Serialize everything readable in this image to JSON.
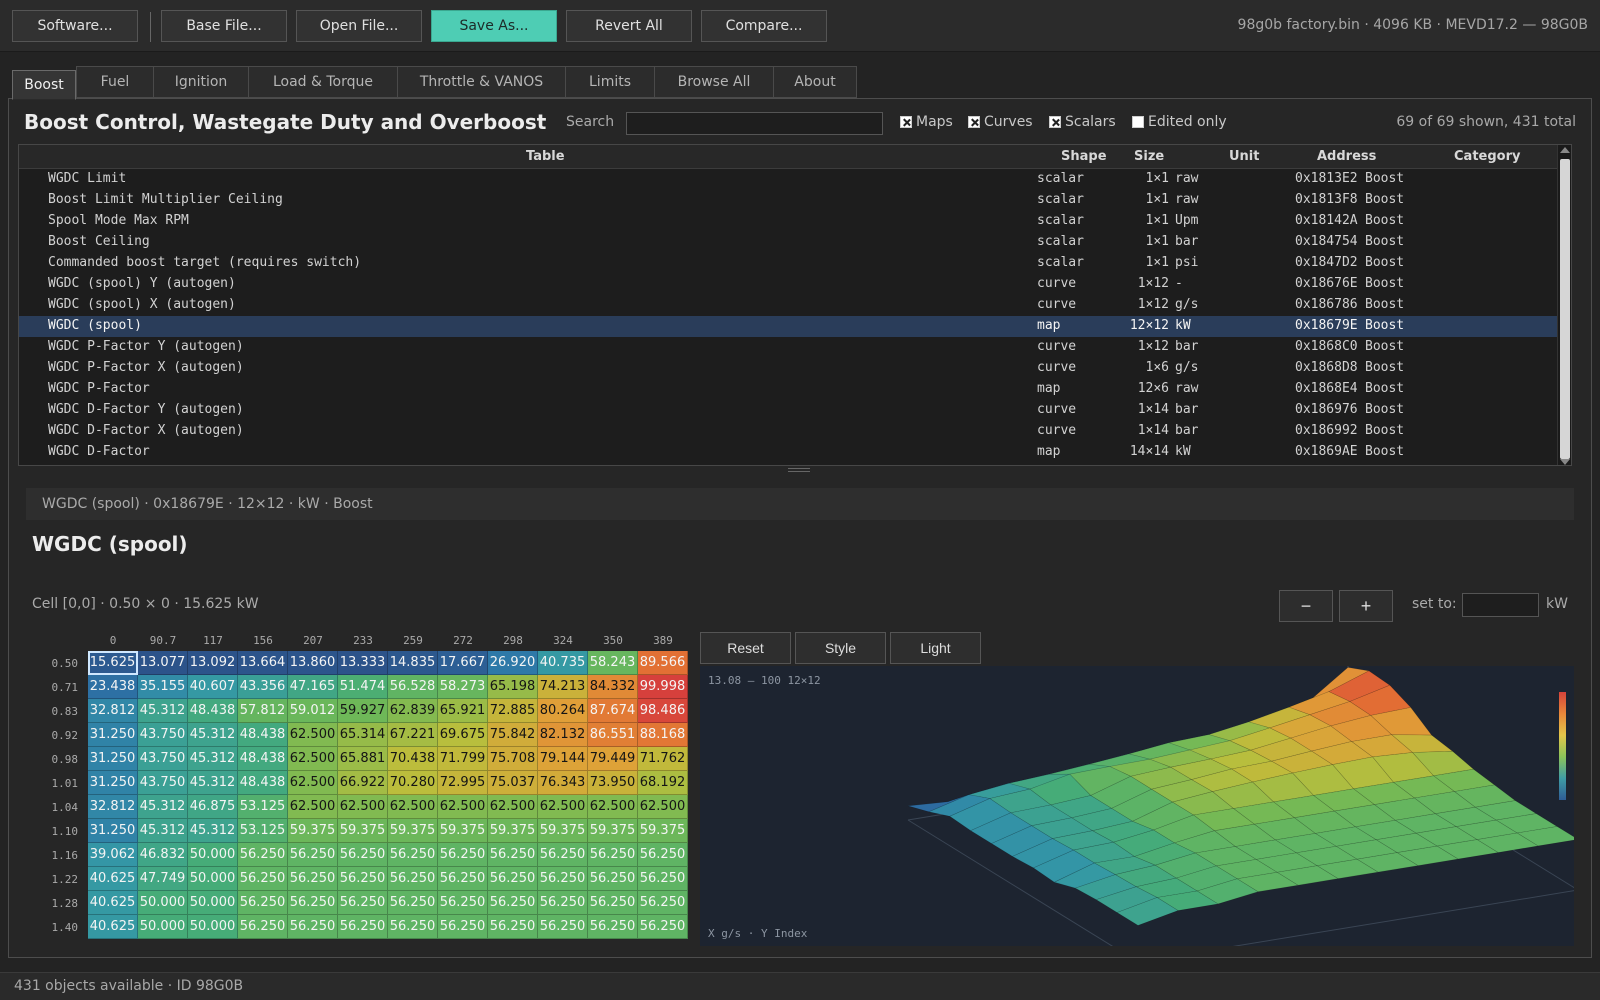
{
  "toolbar": {
    "buttons": [
      "Software...",
      "Base File...",
      "Open File...",
      "Save As...",
      "Revert All",
      "Compare..."
    ],
    "file_info": "98g0b factory.bin  ·  4096 KB  ·  MEVD17.2 — 98G0B"
  },
  "tabs": [
    "Boost",
    "Fuel",
    "Ignition",
    "Load & Torque",
    "Throttle & VANOS",
    "Limits",
    "Browse All",
    "About"
  ],
  "panel": {
    "title": "Boost Control, Wastegate Duty and Overboost",
    "search_label": "Search",
    "search_value": "",
    "filters": [
      "Maps",
      "Curves",
      "Scalars",
      "Edited only"
    ],
    "count": "69 of 69 shown, 431 total"
  },
  "table": {
    "headers": [
      "Table",
      "Shape",
      "Size",
      "Unit",
      "Address",
      "Category"
    ],
    "rows": [
      {
        "name": "WGDC Limit",
        "shape": "scalar",
        "size": "1×1",
        "unit": "raw",
        "addr": "0x1813E2",
        "cat": "Boost"
      },
      {
        "name": "Boost Limit Multiplier Ceiling",
        "shape": "scalar",
        "size": "1×1",
        "unit": "raw",
        "addr": "0x1813F8",
        "cat": "Boost"
      },
      {
        "name": "Spool Mode Max RPM",
        "shape": "scalar",
        "size": "1×1",
        "unit": "Upm",
        "addr": "0x18142A",
        "cat": "Boost"
      },
      {
        "name": "Boost Ceiling",
        "shape": "scalar",
        "size": "1×1",
        "unit": "bar",
        "addr": "0x184754",
        "cat": "Boost"
      },
      {
        "name": "Commanded boost target (requires switch)",
        "shape": "scalar",
        "size": "1×1",
        "unit": "psi",
        "addr": "0x1847D2",
        "cat": "Boost"
      },
      {
        "name": "WGDC (spool) Y (autogen)",
        "shape": "curve",
        "size": "1×12",
        "unit": "-",
        "addr": "0x18676E",
        "cat": "Boost"
      },
      {
        "name": "WGDC (spool) X (autogen)",
        "shape": "curve",
        "size": "1×12",
        "unit": "g/s",
        "addr": "0x186786",
        "cat": "Boost"
      },
      {
        "name": "WGDC (spool)",
        "shape": "map",
        "size": "12×12",
        "unit": "kW",
        "addr": "0x18679E",
        "cat": "Boost"
      },
      {
        "name": "WGDC P-Factor Y (autogen)",
        "shape": "curve",
        "size": "1×12",
        "unit": "bar",
        "addr": "0x1868C0",
        "cat": "Boost"
      },
      {
        "name": "WGDC P-Factor X (autogen)",
        "shape": "curve",
        "size": "1×6",
        "unit": "g/s",
        "addr": "0x1868D8",
        "cat": "Boost"
      },
      {
        "name": "WGDC P-Factor",
        "shape": "map",
        "size": "12×6",
        "unit": "raw",
        "addr": "0x1868E4",
        "cat": "Boost"
      },
      {
        "name": "WGDC D-Factor Y (autogen)",
        "shape": "curve",
        "size": "1×14",
        "unit": "bar",
        "addr": "0x186976",
        "cat": "Boost"
      },
      {
        "name": "WGDC D-Factor X (autogen)",
        "shape": "curve",
        "size": "1×14",
        "unit": "bar",
        "addr": "0x186992",
        "cat": "Boost"
      },
      {
        "name": "WGDC D-Factor",
        "shape": "map",
        "size": "14×14",
        "unit": "kW",
        "addr": "0x1869AE",
        "cat": "Boost"
      }
    ]
  },
  "detail": {
    "breadcrumb": "WGDC (spool)   ·   0x18679E   ·   12×12   ·   kW   ·   Boost",
    "title": "WGDC (spool)",
    "cell_info": "Cell [0,0]  ·  0.50 × 0  ·  15.625 kW",
    "minus": "−",
    "plus": "+",
    "setto_label": "set to:",
    "setto_value": "",
    "unit": "kW",
    "view_buttons": [
      "Reset",
      "Style",
      "Light"
    ],
    "view_range": "13.08 — 100    12×12",
    "view_axes": "X g/s · Y Index"
  },
  "grid": {
    "x_axis": [
      "0",
      "90.7",
      "117",
      "156",
      "207",
      "233",
      "259",
      "272",
      "298",
      "324",
      "350",
      "389"
    ],
    "y_axis": [
      "0.50",
      "0.71",
      "0.83",
      "0.92",
      "0.98",
      "1.01",
      "1.04",
      "1.10",
      "1.16",
      "1.22",
      "1.28",
      "1.40"
    ],
    "values": [
      [
        "15.625",
        "13.077",
        "13.092",
        "13.664",
        "13.860",
        "13.333",
        "14.835",
        "17.667",
        "26.920",
        "40.735",
        "58.243",
        "89.566"
      ],
      [
        "23.438",
        "35.155",
        "40.607",
        "43.356",
        "47.165",
        "51.474",
        "56.528",
        "58.273",
        "65.198",
        "74.213",
        "84.332",
        "99.998"
      ],
      [
        "32.812",
        "45.312",
        "48.438",
        "57.812",
        "59.012",
        "59.927",
        "62.839",
        "65.921",
        "72.885",
        "80.264",
        "87.674",
        "98.486"
      ],
      [
        "31.250",
        "43.750",
        "45.312",
        "48.438",
        "62.500",
        "65.314",
        "67.221",
        "69.675",
        "75.842",
        "82.132",
        "86.551",
        "88.168"
      ],
      [
        "31.250",
        "43.750",
        "45.312",
        "48.438",
        "62.500",
        "65.881",
        "70.438",
        "71.799",
        "75.708",
        "79.144",
        "79.449",
        "71.762"
      ],
      [
        "31.250",
        "43.750",
        "45.312",
        "48.438",
        "62.500",
        "66.922",
        "70.280",
        "72.995",
        "75.037",
        "76.343",
        "73.950",
        "68.192"
      ],
      [
        "32.812",
        "45.312",
        "46.875",
        "53.125",
        "62.500",
        "62.500",
        "62.500",
        "62.500",
        "62.500",
        "62.500",
        "62.500",
        "62.500"
      ],
      [
        "31.250",
        "45.312",
        "45.312",
        "53.125",
        "59.375",
        "59.375",
        "59.375",
        "59.375",
        "59.375",
        "59.375",
        "59.375",
        "59.375"
      ],
      [
        "39.062",
        "46.832",
        "50.000",
        "56.250",
        "56.250",
        "56.250",
        "56.250",
        "56.250",
        "56.250",
        "56.250",
        "56.250",
        "56.250"
      ],
      [
        "40.625",
        "47.749",
        "50.000",
        "56.250",
        "56.250",
        "56.250",
        "56.250",
        "56.250",
        "56.250",
        "56.250",
        "56.250",
        "56.250"
      ],
      [
        "40.625",
        "50.000",
        "50.000",
        "56.250",
        "56.250",
        "56.250",
        "56.250",
        "56.250",
        "56.250",
        "56.250",
        "56.250",
        "56.250"
      ],
      [
        "40.625",
        "50.000",
        "50.000",
        "56.250",
        "56.250",
        "56.250",
        "56.250",
        "56.250",
        "56.250",
        "56.250",
        "56.250",
        "56.250"
      ]
    ]
  },
  "status": "431 objects available   ·   ID 98G0B"
}
